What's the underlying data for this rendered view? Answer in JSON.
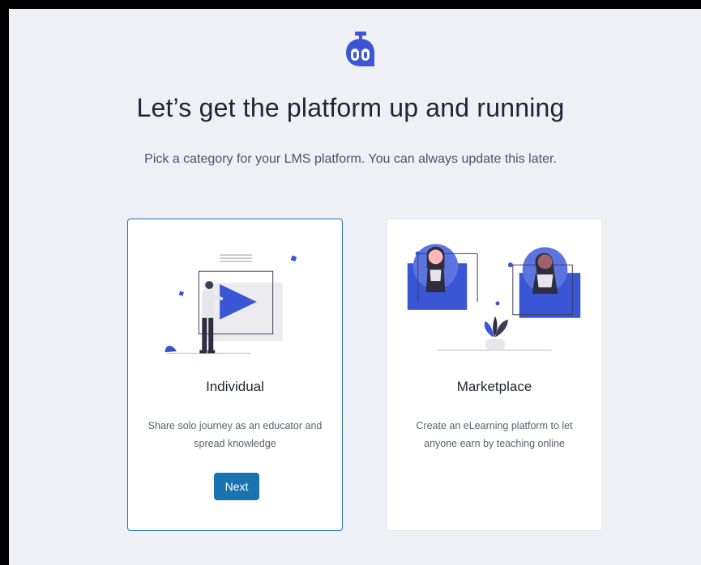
{
  "header": {
    "title": "Let’s get the platform up and running",
    "subtitle": "Pick a category for your LMS platform. You can always update this later."
  },
  "cards": [
    {
      "title": "Individual",
      "description": "Share solo journey as an educator and spread knowledge",
      "button_label": "Next",
      "selected": true
    },
    {
      "title": "Marketplace",
      "description": "Create an eLearning platform to let anyone earn by teaching online",
      "selected": false
    }
  ],
  "colors": {
    "accent": "#1a73b0",
    "brand": "#3a56d4",
    "background": "#eef0f6"
  }
}
